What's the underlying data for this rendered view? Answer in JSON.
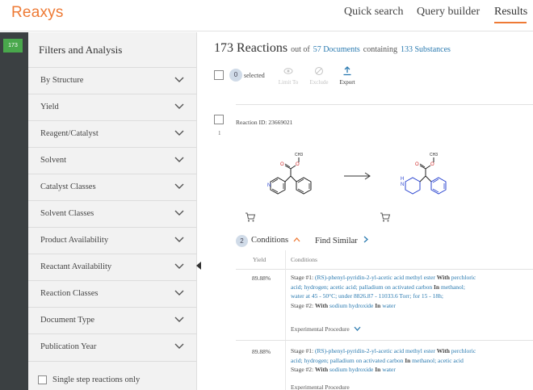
{
  "header": {
    "logo": "Reaxys",
    "nav": [
      "Quick search",
      "Query builder",
      "Results"
    ]
  },
  "rail": {
    "badge": "173"
  },
  "filters": {
    "title": "Filters and Analysis",
    "items": [
      "By Structure",
      "Yield",
      "Reagent/Catalyst",
      "Solvent",
      "Catalyst Classes",
      "Solvent Classes",
      "Product Availability",
      "Reactant Availability",
      "Reaction Classes",
      "Document Type",
      "Publication Year"
    ],
    "single_step": "Single step reactions only"
  },
  "results": {
    "count": "173 Reactions",
    "out_of": "out of",
    "documents": "57 Documents",
    "containing": "containing",
    "substances": "133 Substances"
  },
  "toolbar": {
    "selected_count": "0",
    "selected_label": "selected",
    "limit_to": "Limit To",
    "exclude": "Exclude",
    "export": "Export"
  },
  "reaction": {
    "number": "1",
    "id_label": "Reaction ID: 23669021",
    "reactant_label": "CH3",
    "product_label": "CH3",
    "conditions_count": "2",
    "conditions_label": "Conditions",
    "find_similar": "Find Similar",
    "col_yield": "Yield",
    "col_conditions": "Conditions",
    "rows": [
      {
        "yield": "89.88%",
        "stage1_prefix": "Stage #1:",
        "stage1_reactant": "(RS)-phenyl-pyridin-2-yl-acetic acid methyl ester",
        "with1": "With",
        "stage1_reagents_line1": "perchloric",
        "stage1_reagents_line2": "acid;  hydrogen;  acetic acid;  palladium on activated carbon",
        "in1": "In",
        "solvent1": "methanol;",
        "line3": "water at 45 - 50°C; under 8826.87 - 11033.6 Torr; for 15 - 18h;",
        "stage2_prefix": "Stage #2:",
        "with2": "With",
        "stage2_reagent": "sodium hydroxide",
        "in2": "In",
        "solvent2": "water",
        "exp_proc": "Experimental Procedure"
      },
      {
        "yield": "89.88%",
        "stage1_prefix": "Stage #1:",
        "stage1_reactant": "(RS)-phenyl-pyridin-2-yl-acetic acid methyl ester",
        "with1": "With",
        "stage1_reagents_line1": "perchloric",
        "stage1_reagents_line2": "acid;  hydrogen;  palladium on activated carbon",
        "in1": "In",
        "solvent1": "methanol;  acetic acid",
        "stage2_prefix": "Stage #2:",
        "with2": "With",
        "stage2_reagent": "sodium hydroxide",
        "in2": "In",
        "solvent2": "water",
        "exp_proc": "Experimental Procedure"
      }
    ]
  },
  "colors": {
    "accent": "#ee7a35",
    "link": "#2a7ab0",
    "rail": "#3b4042",
    "badge_green": "#49a84c",
    "panel": "#f2f2f2"
  }
}
